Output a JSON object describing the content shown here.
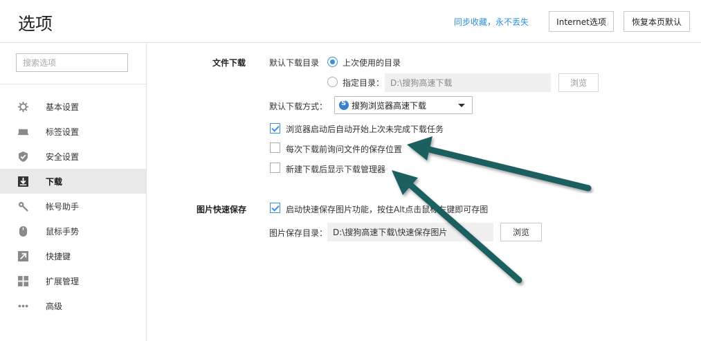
{
  "header": {
    "title": "选项",
    "sync_link": "同步收藏，永不丢失",
    "internet_btn": "Internet选项",
    "reset_btn": "恢复本页默认"
  },
  "sidebar": {
    "search_placeholder": "搜索选项",
    "items": [
      {
        "label": "基本设置",
        "icon": "gear-icon"
      },
      {
        "label": "标签设置",
        "icon": "tab-icon"
      },
      {
        "label": "安全设置",
        "icon": "shield-icon"
      },
      {
        "label": "下载",
        "icon": "download-icon",
        "active": true
      },
      {
        "label": "帐号助手",
        "icon": "key-icon"
      },
      {
        "label": "鼠标手势",
        "icon": "mouse-icon"
      },
      {
        "label": "快捷键",
        "icon": "shortcut-icon"
      },
      {
        "label": "扩展管理",
        "icon": "extensions-icon"
      },
      {
        "label": "高级",
        "icon": "more-icon"
      }
    ]
  },
  "download": {
    "section_title": "文件下载",
    "default_dir_label": "默认下载目录",
    "last_used_label": "上次使用的目录",
    "specified_dir_label": "指定目录：",
    "specified_dir_value": "D:\\搜狗高速下载",
    "browse_label": "浏览",
    "method_label": "默认下载方式：",
    "method_value": "搜狗浏览器高速下载",
    "opt_resume": "浏览器启动后自动开始上次未完成下载任务",
    "opt_ask_location": "每次下载前询问文件的保存位置",
    "opt_show_manager": "新建下载后显示下载管理器"
  },
  "image_save": {
    "section_title": "图片快速保存",
    "opt_enable": "启动快速保存图片功能，按住Alt点击鼠标左键即可存图",
    "dir_label": "图片保存目录：",
    "dir_value": "D:\\搜狗高速下载\\快速保存图片",
    "browse_label": "浏览"
  },
  "colors": {
    "accent": "#3b8fe0",
    "link": "#2d8fd8",
    "arrow": "#1e5e5e"
  }
}
